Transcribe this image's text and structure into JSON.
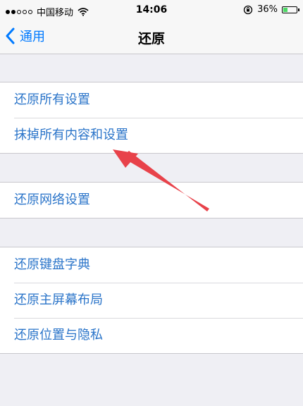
{
  "status_bar": {
    "carrier": "中国移动",
    "time": "14:06",
    "battery_text": "36%",
    "battery_level": 0.36,
    "signal_dots_filled": 2
  },
  "nav": {
    "back_label": "通用",
    "title": "还原"
  },
  "groups": [
    {
      "items": [
        "还原所有设置",
        "抹掉所有内容和设置"
      ]
    },
    {
      "items": [
        "还原网络设置"
      ]
    },
    {
      "items": [
        "还原键盘字典",
        "还原主屏幕布局",
        "还原位置与隐私"
      ]
    }
  ],
  "colors": {
    "accent": "#007aff",
    "cell_text": "#2a74c9",
    "annotation_arrow": "#e8424a",
    "battery_fill": "#4cd964"
  },
  "icons": {
    "back": "chevron-left-icon",
    "wifi": "wifi-icon",
    "lock_rotation": "orientation-lock-icon",
    "battery": "battery-icon"
  }
}
